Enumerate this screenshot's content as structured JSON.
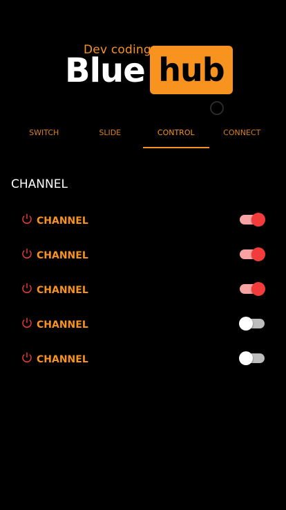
{
  "logo": {
    "subtitle": "Dev coding",
    "word1": "Blue",
    "word2": "hub"
  },
  "tabs": [
    {
      "label": "SWITCH",
      "active": false
    },
    {
      "label": "SLIDE",
      "active": false
    },
    {
      "label": "CONTROL",
      "active": true
    },
    {
      "label": "CONNECT",
      "active": false
    }
  ],
  "section": {
    "title": "CHANNEL"
  },
  "channels": [
    {
      "label": "CHANNEL",
      "on": true,
      "icon": "power-icon"
    },
    {
      "label": "CHANNEL",
      "on": true,
      "icon": "power-icon"
    },
    {
      "label": "CHANNEL",
      "on": true,
      "icon": "power-icon"
    },
    {
      "label": "CHANNEL",
      "on": false,
      "icon": "power-icon"
    },
    {
      "label": "CHANNEL",
      "on": false,
      "icon": "power-icon"
    }
  ],
  "colors": {
    "accent": "#f7931e",
    "toggle_on": "#f23c3c",
    "power_icon": "#e53935",
    "background": "#000000"
  }
}
